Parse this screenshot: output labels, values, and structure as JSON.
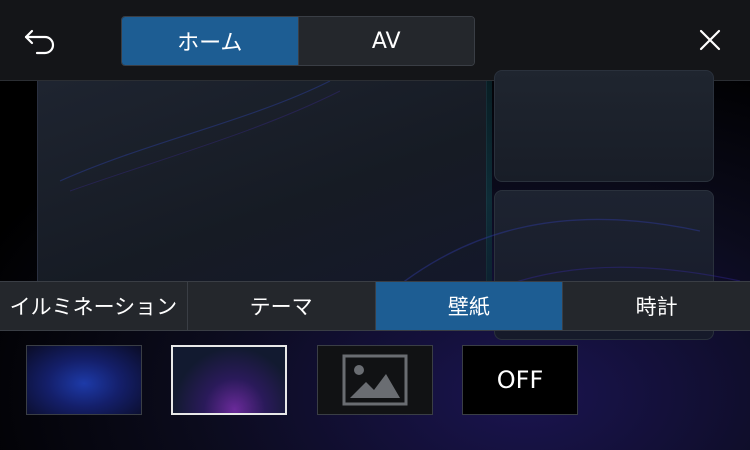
{
  "header": {
    "tabs": [
      {
        "label": "ホーム",
        "active": true
      },
      {
        "label": "AV",
        "active": false
      }
    ],
    "back_icon": "back-arrow-icon",
    "close_icon": "close-icon"
  },
  "settings_tabs": [
    {
      "label": "イルミネーション",
      "active": false
    },
    {
      "label": "テーマ",
      "active": false
    },
    {
      "label": "壁紙",
      "active": true
    },
    {
      "label": "時計",
      "active": false
    }
  ],
  "wallpapers": [
    {
      "id": "blue",
      "selected": false
    },
    {
      "id": "purple-curves",
      "selected": true
    },
    {
      "id": "custom-image",
      "icon": "image-icon",
      "selected": false
    },
    {
      "id": "off",
      "label": "OFF",
      "selected": false
    }
  ],
  "colors": {
    "accent": "#1d5d93",
    "tab_bg": "#24272c",
    "border": "#3a3e45"
  }
}
